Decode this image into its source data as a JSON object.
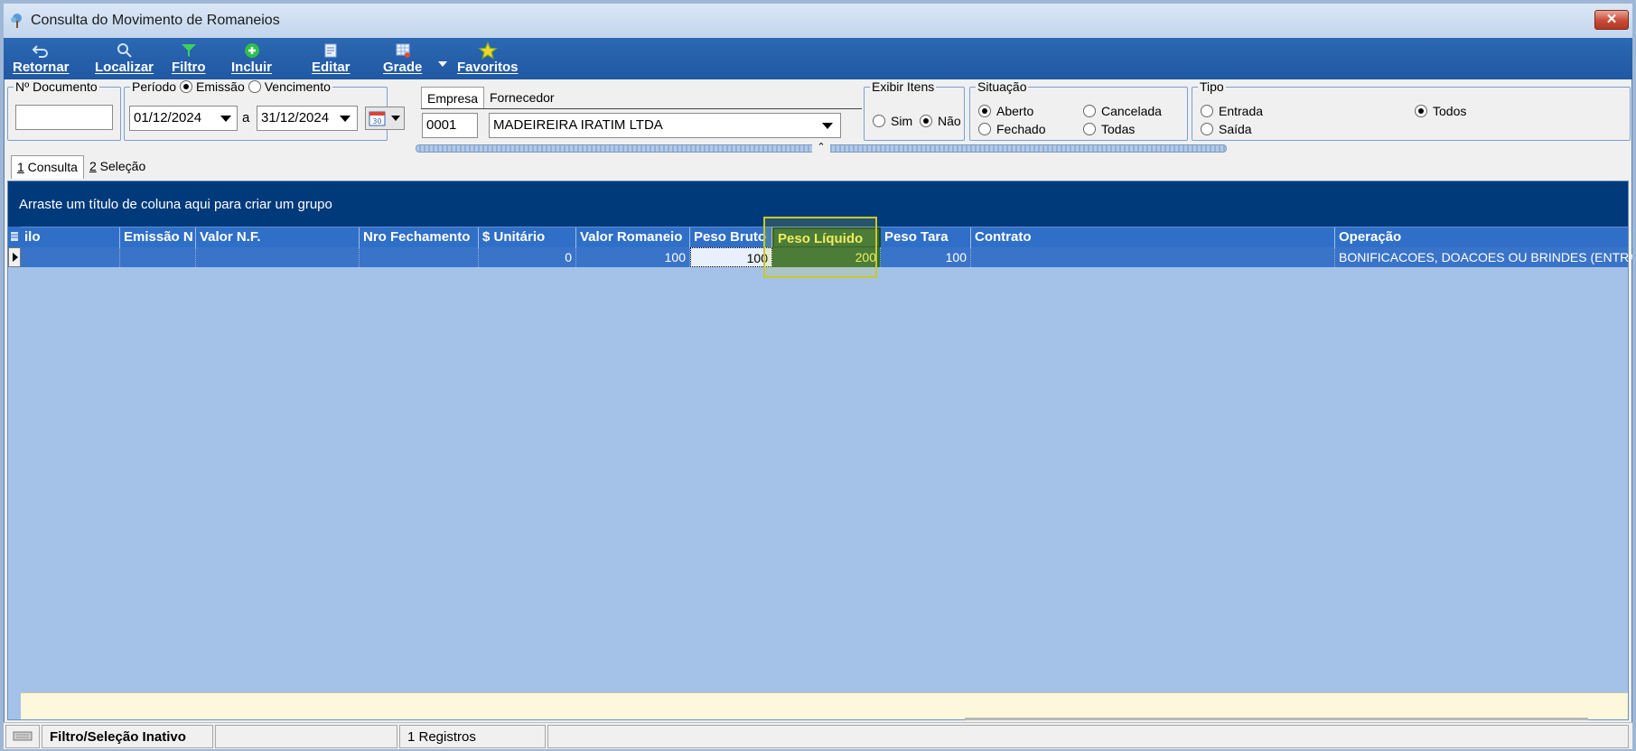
{
  "window": {
    "title": "Consulta do Movimento de Romaneios",
    "close_label": "✕"
  },
  "toolbar": {
    "buttons": [
      {
        "label": "Retornar",
        "icon": "undo-arrow-icon"
      },
      {
        "label": "Localizar",
        "icon": "magnifier-icon"
      },
      {
        "label": "Filtro",
        "icon": "funnel-icon"
      },
      {
        "label": "Incluir",
        "icon": "plus-circle-icon"
      },
      {
        "label": "Editar",
        "icon": "edit-doc-icon"
      },
      {
        "label": "Grade",
        "icon": "grid-icon"
      },
      {
        "label": "Favoritos",
        "icon": "star-icon"
      }
    ]
  },
  "filters": {
    "documento": {
      "label": "Nº Documento",
      "value": ""
    },
    "periodo": {
      "label": "Período",
      "emissao_label": "Emissão",
      "vencimento_label": "Vencimento",
      "selected": "Emissão",
      "from": "01/12/2024",
      "separator": "a",
      "to": "31/12/2024"
    },
    "tabs": {
      "empresa": "Empresa",
      "fornecedor": "Fornecedor"
    },
    "empresa_code": "0001",
    "empresa_name": "MADEIREIRA IRATIM LTDA",
    "exibir_itens": {
      "label": "Exibir Itens",
      "sim": "Sim",
      "nao": "Não",
      "selected": "Não"
    },
    "situacao": {
      "label": "Situação",
      "aberto": "Aberto",
      "cancelada": "Cancelada",
      "fechado": "Fechado",
      "todas": "Todas",
      "selected": "Aberto"
    },
    "tipo": {
      "label": "Tipo",
      "entrada": "Entrada",
      "saida": "Saída",
      "todos": "Todos",
      "selected": "Todos"
    }
  },
  "page_tabs": [
    {
      "num": "1",
      "label": " Consulta"
    },
    {
      "num": "2",
      "label": " Seleção"
    }
  ],
  "grid": {
    "group_hint": "Arraste um título de coluna aqui para criar um grupo",
    "columns": [
      "ilo",
      "Emissão N",
      "Valor N.F.",
      "Nro Fechamento",
      "$ Unitário",
      "Valor Romaneio",
      "Peso Bruto",
      "Peso Líquido",
      "Peso Tara",
      "Contrato",
      "Operação"
    ],
    "rows": [
      [
        "",
        "",
        "",
        "",
        "0",
        "100",
        "100",
        "200",
        "100",
        "",
        "BONIFICACOES, DOACOES OU BRINDES (ENTRA"
      ]
    ]
  },
  "statusbar": {
    "filter_state": "Filtro/Seleção Inativo",
    "blank": "",
    "records": "1 Registros"
  },
  "colors": {
    "accent": "#2058a3",
    "grid_bg": "#a4c2e8",
    "group_panel": "#003a7a",
    "selected_col": "#2e6a3c"
  }
}
